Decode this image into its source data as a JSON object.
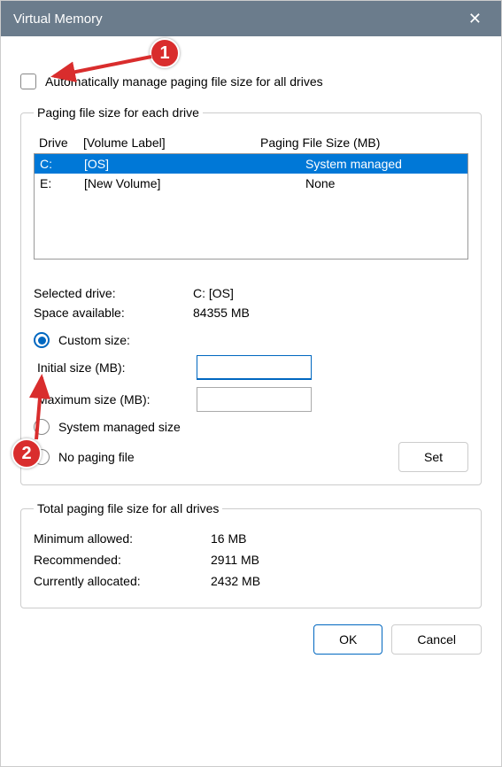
{
  "window": {
    "title": "Virtual Memory"
  },
  "auto_manage_label": "Automatically manage paging file size for all drives",
  "drives_group": {
    "legend": "Paging file size for each drive",
    "header_drive": "Drive",
    "header_volume": "[Volume Label]",
    "header_size": "Paging File Size (MB)",
    "rows": [
      {
        "drive": "C:",
        "volume": "[OS]",
        "size": "System managed",
        "selected": true
      },
      {
        "drive": "E:",
        "volume": "[New Volume]",
        "size": "None",
        "selected": false
      }
    ]
  },
  "selected_drive_label": "Selected drive:",
  "selected_drive_value": "C:  [OS]",
  "space_available_label": "Space available:",
  "space_available_value": "84355 MB",
  "radio_custom": "Custom size:",
  "initial_size_label": "Initial size (MB):",
  "initial_size_value": "",
  "maximum_size_label": "Maximum size (MB):",
  "maximum_size_value": "",
  "radio_system": "System managed size",
  "radio_none": "No paging file",
  "set_button": "Set",
  "totals_group": {
    "legend": "Total paging file size for all drives",
    "min_label": "Minimum allowed:",
    "min_value": "16 MB",
    "rec_label": "Recommended:",
    "rec_value": "2911 MB",
    "cur_label": "Currently allocated:",
    "cur_value": "2432 MB"
  },
  "ok_button": "OK",
  "cancel_button": "Cancel",
  "annotations": {
    "callout1": "1",
    "callout2": "2"
  }
}
